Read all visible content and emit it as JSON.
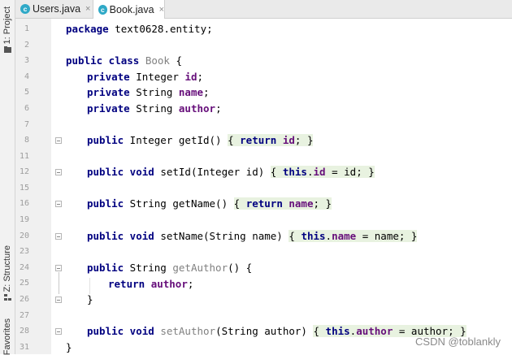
{
  "sidebar": {
    "project_tab": "1: Project",
    "structure_tab": "Z: Structure",
    "favorites_tab": "Favorites"
  },
  "tabs": [
    {
      "label": "Users.java",
      "icon": "java-class-icon",
      "close": "×"
    },
    {
      "label": "Book.java",
      "icon": "java-class-icon",
      "close": "×"
    }
  ],
  "editor": {
    "line_numbers": [
      "1",
      "2",
      "3",
      "4",
      "5",
      "6",
      "7",
      "8",
      "11",
      "12",
      "15",
      "16",
      "19",
      "20",
      "23",
      "24",
      "25",
      "26",
      "27",
      "28",
      "31"
    ],
    "lines": [
      {
        "kw": "package",
        "rest": " text0628.entity;"
      },
      {
        "kw": "public class",
        "unused": "Book",
        "rest": " {"
      },
      {
        "kw": "private",
        "type": "Integer ",
        "field": "id",
        "end": ";"
      },
      {
        "kw": "private",
        "type": "String ",
        "field": "name",
        "end": ";"
      },
      {
        "kw": "private",
        "type": "String ",
        "field": "author",
        "end": ";"
      },
      {
        "kw": "public",
        "sig": " Integer getId() ",
        "body_kw": "return",
        "field": "id",
        "end": "; }"
      },
      {
        "kw": "public void",
        "sig": " setId(Integer id) ",
        "body_kw": "this",
        "field": "id",
        "end": " = id; }"
      },
      {
        "kw": "public",
        "sig": " String getName() ",
        "body_kw": "return",
        "field": "name",
        "end": "; }"
      },
      {
        "kw": "public void",
        "sig": " setName(String name) ",
        "body_kw": "this",
        "field": "name",
        "end": " = name; }"
      },
      {
        "kw": "public",
        "type": " String ",
        "unused": "getAuthor",
        "rest": "() {"
      },
      {
        "kw": "return",
        "field": "author",
        "end": ";"
      },
      {
        "rest": "}"
      },
      {
        "kw": "public void",
        "unused": "setAuthor",
        "sig": "(String author) ",
        "body_kw": "this",
        "field": "author",
        "end": " = author; }"
      },
      {
        "rest": "}"
      }
    ]
  },
  "watermark": "CSDN @toblankly",
  "colors": {
    "keyword": "#000080",
    "field": "#660e7a",
    "unused": "#808080",
    "fold_highlight": "#e8f2e0",
    "class_icon": "#2fa9c7"
  }
}
